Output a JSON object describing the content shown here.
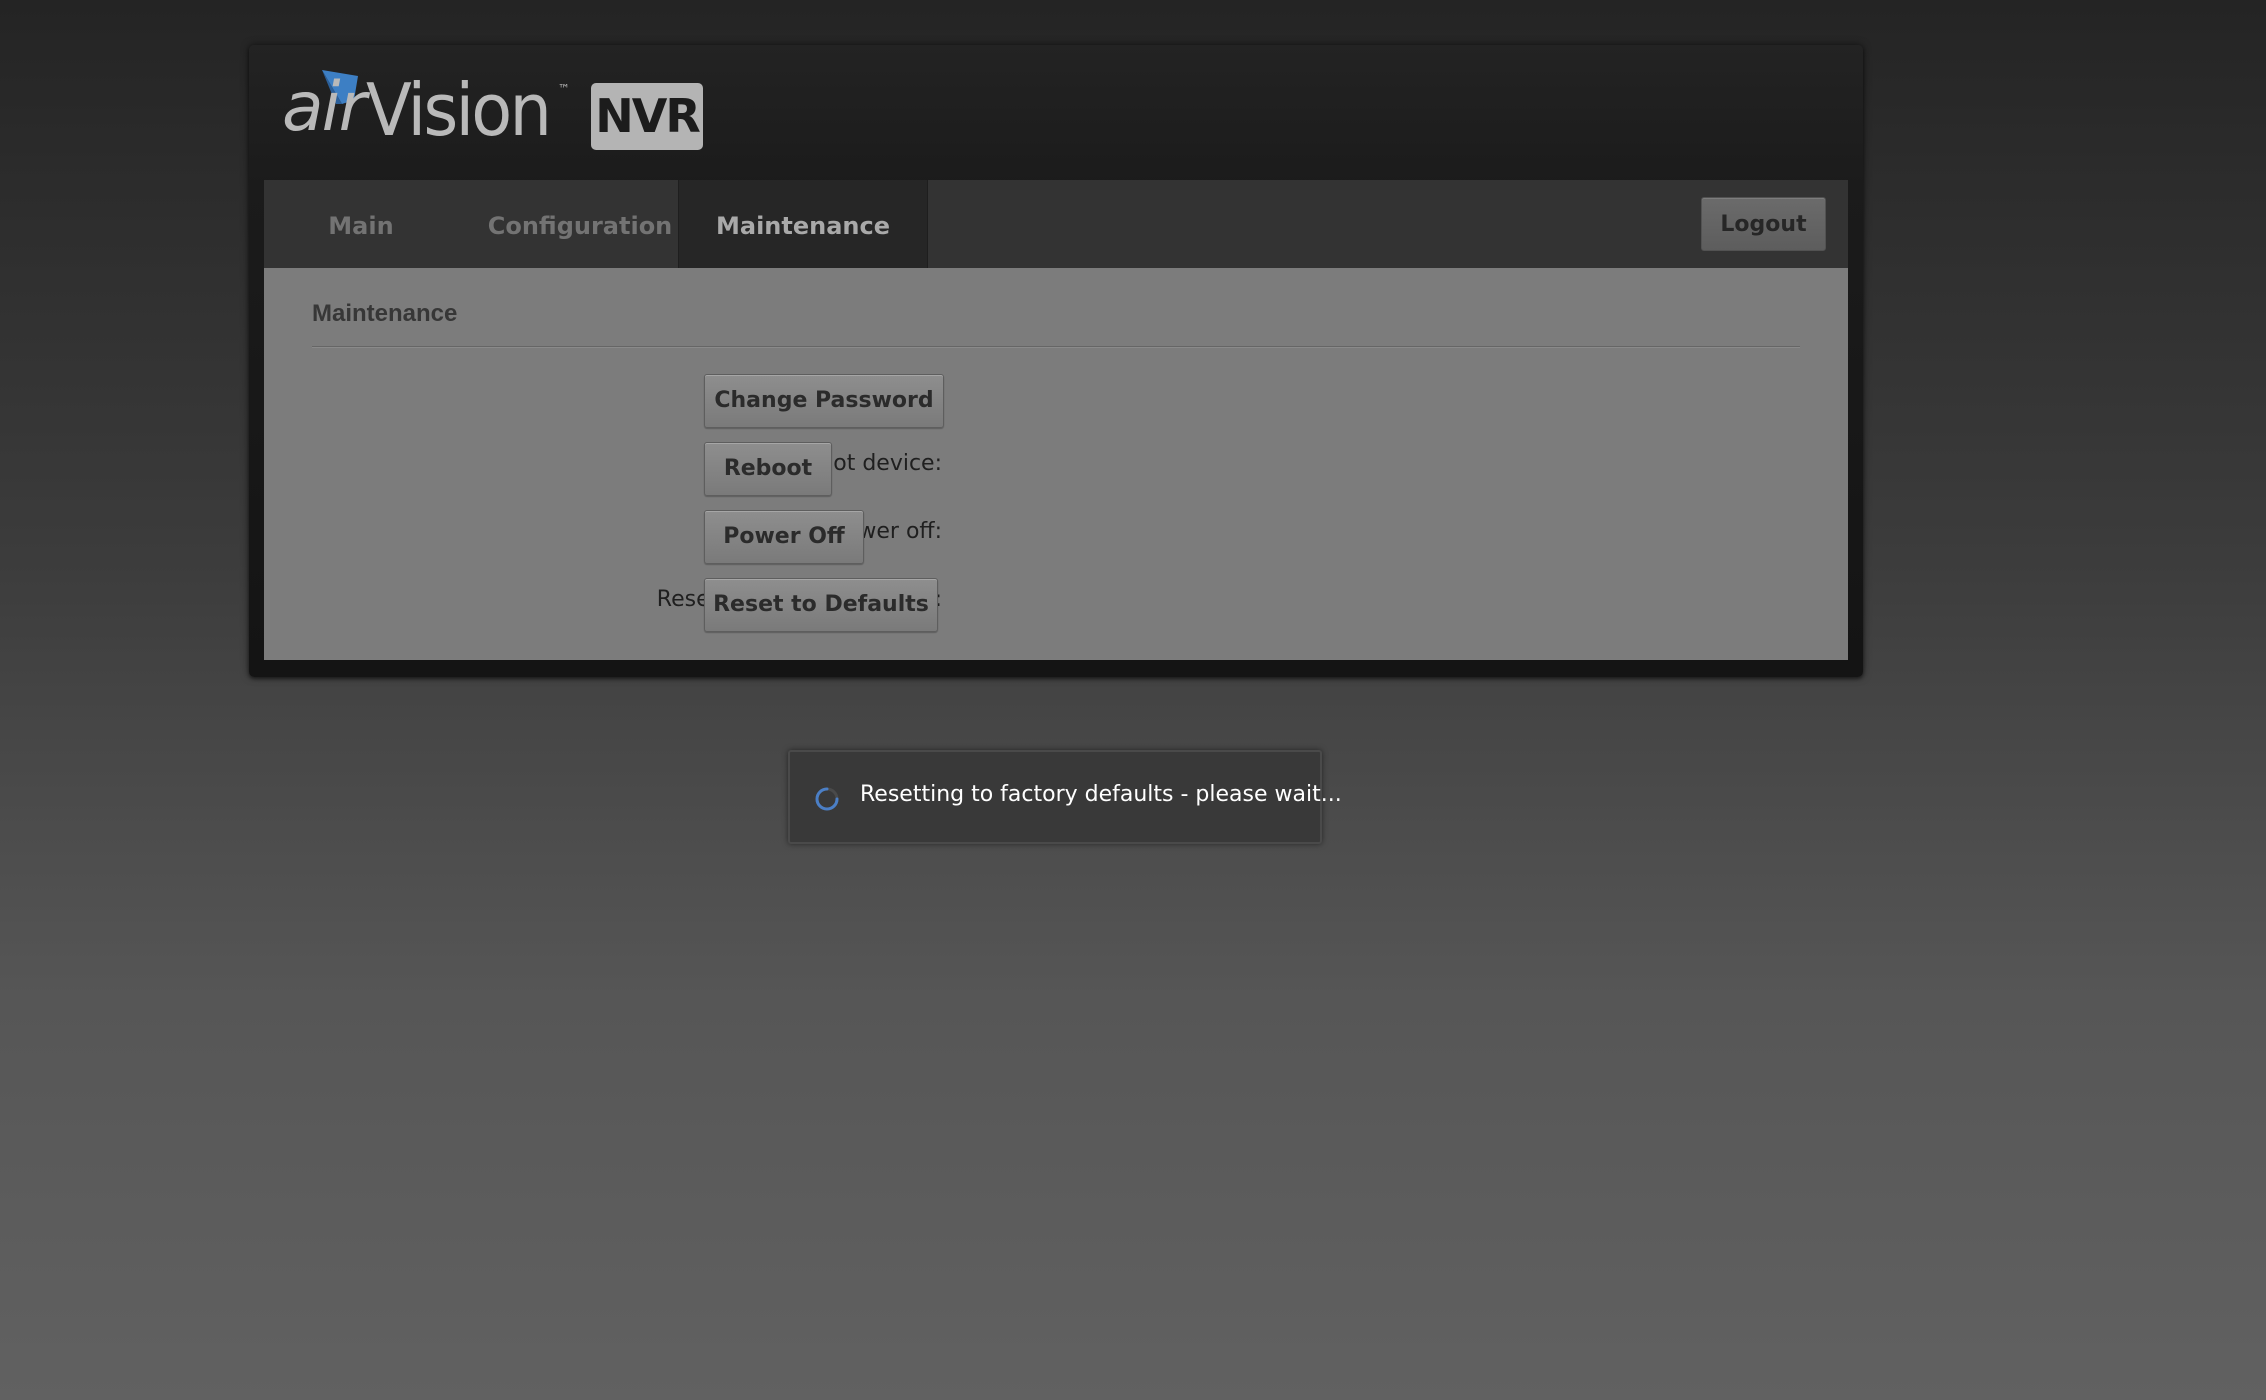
{
  "brand": {
    "logo_air": "air",
    "logo_vision": "Vision",
    "logo_tm": "™",
    "logo_nvr": "NVR",
    "accent_color": "#3d7fc4"
  },
  "nav": {
    "tabs": [
      {
        "label": "Main",
        "active": false
      },
      {
        "label": "Configuration",
        "active": false
      },
      {
        "label": "Maintenance",
        "active": true
      }
    ],
    "logout_label": "Logout"
  },
  "maintenance": {
    "section_title": "Maintenance",
    "rows": [
      {
        "label": "Change Password:",
        "button": "Change Password"
      },
      {
        "label": "Reboot device:",
        "button": "Reboot"
      },
      {
        "label": "Power off:",
        "button": "Power Off"
      },
      {
        "label": "Reset To Factory Defaults:",
        "button": "Reset to Defaults"
      }
    ]
  },
  "toast": {
    "icon": "spinner-icon",
    "message": "Resetting to factory defaults - please wait..."
  }
}
